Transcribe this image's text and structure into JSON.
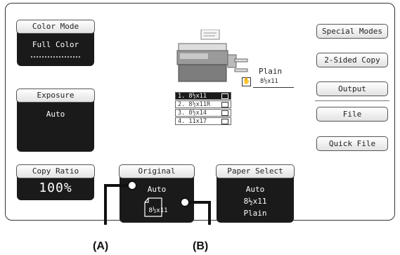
{
  "color_mode": {
    "tab": "Color Mode",
    "value": "Full Color"
  },
  "exposure": {
    "tab": "Exposure",
    "value": "Auto"
  },
  "copy_ratio": {
    "tab": "Copy Ratio",
    "value": "100%"
  },
  "original": {
    "tab": "Original",
    "value": "Auto",
    "size": "8½x11"
  },
  "paper_select": {
    "tab": "Paper Select",
    "line1": "Auto",
    "line2": "8½x11",
    "line3": "Plain"
  },
  "bypass": {
    "type": "Plain",
    "size": "8½x11"
  },
  "trays": [
    {
      "label": "1. 8½x11",
      "selected": true
    },
    {
      "label": "2. 8½x11R",
      "selected": false
    },
    {
      "label": "3. 8½x14",
      "selected": false
    },
    {
      "label": "4. 11x17",
      "selected": false
    }
  ],
  "right_menu": {
    "special_modes": "Special Modes",
    "two_sided_copy": "2-Sided Copy",
    "output": "Output",
    "file": "File",
    "quick_file": "Quick File"
  },
  "callouts": {
    "a": "(A)",
    "b": "(B)"
  },
  "icons": [
    "machine-icon",
    "hand-feed-icon",
    "document-icon",
    "tray-icon"
  ]
}
